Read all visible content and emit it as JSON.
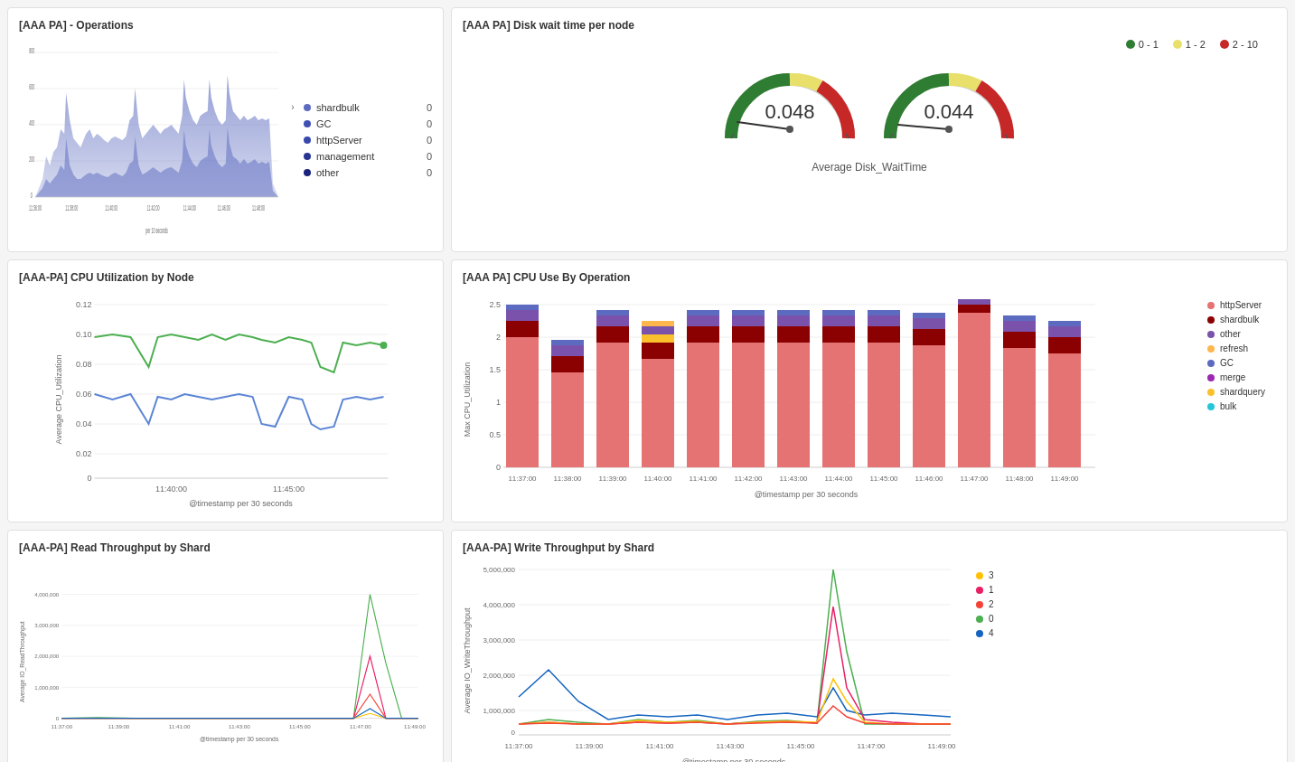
{
  "panels": {
    "operations": {
      "title": "[AAA PA] - Operations",
      "xLabel": "per 10 seconds",
      "xTicks": [
        "11:36:00",
        "11:38:00",
        "11:40:00",
        "11:42:00",
        "11:44:00",
        "11:46:00",
        "11:48:00"
      ],
      "yTicks": [
        "0",
        "200",
        "400",
        "600",
        "800"
      ],
      "legend": [
        {
          "label": "shardbulk",
          "value": "0",
          "color": "#5c6bc0",
          "expand": true
        },
        {
          "label": "GC",
          "value": "0",
          "color": "#3f51b5"
        },
        {
          "label": "httpServer",
          "value": "0",
          "color": "#3949ab"
        },
        {
          "label": "management",
          "value": "0",
          "color": "#283593"
        },
        {
          "label": "other",
          "value": "0",
          "color": "#1a237e"
        }
      ]
    },
    "disk": {
      "title": "[AAA PA] Disk wait time per node",
      "legend": [
        {
          "label": "0 - 1",
          "color": "#2e7d32"
        },
        {
          "label": "1 - 2",
          "color": "#f5f59a"
        },
        {
          "label": "2 - 10",
          "color": "#c62828"
        }
      ],
      "gauge1": {
        "value": "0.048"
      },
      "gauge2": {
        "value": "0.044"
      },
      "subtitle": "Average Disk_WaitTime"
    },
    "cpu_node": {
      "title": "[AAA-PA] CPU Utilization by Node",
      "yLabel": "Average CPU_Utilization",
      "xLabel": "@timestamp per 30 seconds",
      "xTicks": [
        "11:40:00",
        "11:45:00"
      ],
      "yTicks": [
        "0",
        "0.02",
        "0.04",
        "0.06",
        "0.08",
        "0.10",
        "0.12"
      ]
    },
    "cpu_op": {
      "title": "[AAA PA] CPU Use By Operation",
      "yLabel": "Max CPU_Utilization",
      "xLabel": "@timestamp per 30 seconds",
      "xTicks": [
        "11:37:00",
        "11:38:00",
        "11:39:00",
        "11:40:00",
        "11:41:00",
        "11:42:00",
        "11:43:00",
        "11:44:00",
        "11:45:00",
        "11:46:00",
        "11:47:00",
        "11:48:00",
        "11:49:00"
      ],
      "yTicks": [
        "0",
        "0.5",
        "1",
        "1.5",
        "2",
        "2.5"
      ],
      "legend": [
        {
          "label": "httpServer",
          "color": "#e57373"
        },
        {
          "label": "shardbulk",
          "color": "#8b0000"
        },
        {
          "label": "other",
          "color": "#7b52ab"
        },
        {
          "label": "refresh",
          "color": "#ffb74d"
        },
        {
          "label": "GC",
          "color": "#5c6bc0"
        },
        {
          "label": "merge",
          "color": "#9c27b0"
        },
        {
          "label": "shardquery",
          "color": "#fbc02d"
        },
        {
          "label": "bulk",
          "color": "#26c6da"
        }
      ]
    },
    "read_throughput": {
      "title": "[AAA-PA] Read Throughput by Shard",
      "yLabel": "Average IO_ReadThroughput",
      "xLabel": "@timestamp per 30 seconds",
      "xTicks": [
        "11:37:00",
        "11:39:00",
        "11:41:00",
        "11:43:00",
        "11:45:00",
        "11:47:00",
        "11:49:00"
      ],
      "yTicks": [
        "0",
        "1,000,000",
        "2,000,000",
        "3,000,000",
        "4,000,000"
      ],
      "legend": [
        {
          "label": "3",
          "color": "#ffc107"
        },
        {
          "label": "1",
          "color": "#e91e63"
        },
        {
          "label": "2",
          "color": "#f44336"
        },
        {
          "label": "0",
          "color": "#4caf50"
        },
        {
          "label": "4",
          "color": "#1565c0"
        }
      ]
    },
    "write_throughput": {
      "title": "[AAA-PA] Write Throughput by Shard",
      "yLabel": "Average IO_WriteThroughput",
      "xLabel": "@timestamp per 30 seconds",
      "xTicks": [
        "11:37:00",
        "11:39:00",
        "11:41:00",
        "11:43:00",
        "11:45:00",
        "11:47:00",
        "11:49:00"
      ],
      "yTicks": [
        "0",
        "1,000,000",
        "2,000,000",
        "3,000,000",
        "4,000,000",
        "5,000,000"
      ],
      "legend": [
        {
          "label": "3",
          "color": "#ffc107"
        },
        {
          "label": "1",
          "color": "#e91e63"
        },
        {
          "label": "2",
          "color": "#f44336"
        },
        {
          "label": "0",
          "color": "#4caf50"
        },
        {
          "label": "4",
          "color": "#1565c0"
        }
      ]
    }
  }
}
